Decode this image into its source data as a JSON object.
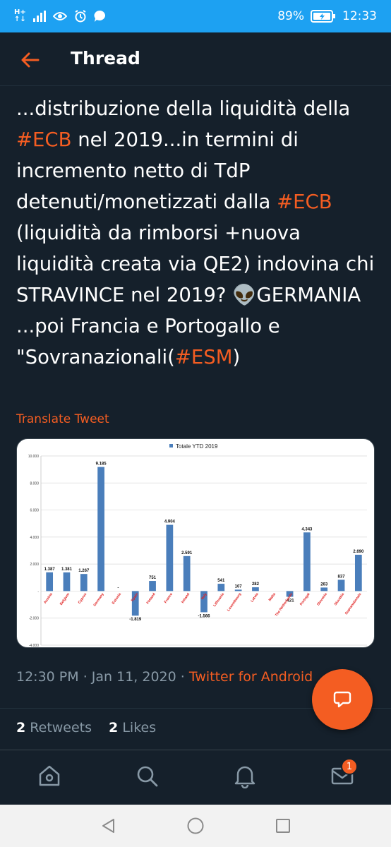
{
  "status": {
    "network": "H+\n↑↓",
    "battery": "89%",
    "time": "12:33"
  },
  "header": {
    "title": "Thread"
  },
  "tweet": {
    "segments": [
      {
        "text": "...distribuzione della liquidità della ",
        "tag": false
      },
      {
        "text": "#ECB",
        "tag": true
      },
      {
        "text": " nel 2019...in termini di incremento netto di TdP detenuti/monetizzati  dalla ",
        "tag": false
      },
      {
        "text": "#ECB",
        "tag": true
      },
      {
        "text": "  (liquidità da rimborsi +nuova liquidità creata via QE2) indovina chi STRAVINCE nel 2019? 👽GERMANIA ...poi Francia e Portogallo e \"Sovranazionali(",
        "tag": false
      },
      {
        "text": "#ESM",
        "tag": true
      },
      {
        "text": ")",
        "tag": false
      }
    ],
    "translate_label": "Translate Tweet",
    "time": "12:30 PM",
    "date": "Jan 11, 2020",
    "separator": "·",
    "via": "Twitter for Android",
    "retweets_count": "2",
    "retweets_label": "Retweets",
    "likes_count": "2",
    "likes_label": "Likes"
  },
  "tabbar": {
    "badge": "1"
  },
  "icons": {
    "back": "arrow-left-icon",
    "fab": "reply-bubble-icon",
    "tabs": [
      "home-icon",
      "search-icon",
      "notifications-bell-icon",
      "messages-envelope-icon"
    ],
    "nav": [
      "back-triangle-icon",
      "home-circle-icon",
      "recents-square-icon"
    ]
  },
  "colors": {
    "accent": "#f45d22",
    "statusbar": "#1da1f2",
    "background": "#15202b",
    "muted": "#8899a6",
    "bar": "#4a7ebb"
  },
  "chart_data": {
    "type": "bar",
    "legend": "Totale YTD 2019",
    "categories": [
      "Austria",
      "Belgium",
      "Cyprus",
      "Germany",
      "Estonia",
      "Spain",
      "Finland",
      "France",
      "Ireland",
      "Italy",
      "Lithuania",
      "Luxembourg",
      "Latvia",
      "Malta",
      "The Netherlands",
      "Portugal",
      "Slovenia",
      "Slovakia",
      "Supranationals"
    ],
    "values": [
      1387,
      1381,
      1267,
      9185,
      0,
      -1819,
      751,
      4904,
      2591,
      -1566,
      541,
      107,
      282,
      0,
      -421,
      4343,
      263,
      837,
      2690
    ],
    "data_labels": [
      "1.387",
      "1.381",
      "1.267",
      "9.185",
      "-",
      "-1.819",
      "751",
      "4.904",
      "2.591",
      "-1.566",
      "541",
      "107",
      "282",
      "",
      "-421",
      "4.343",
      "263",
      "837",
      "2.690"
    ],
    "yticks": [
      -4000,
      -2000,
      0,
      2000,
      4000,
      6000,
      8000,
      10000
    ],
    "ytick_labels": [
      "-4.000",
      "-2.000",
      "-",
      "2.000",
      "4.000",
      "6.000",
      "8.000",
      "10.000"
    ],
    "ylim": [
      -4000,
      10000
    ],
    "grid": true
  }
}
